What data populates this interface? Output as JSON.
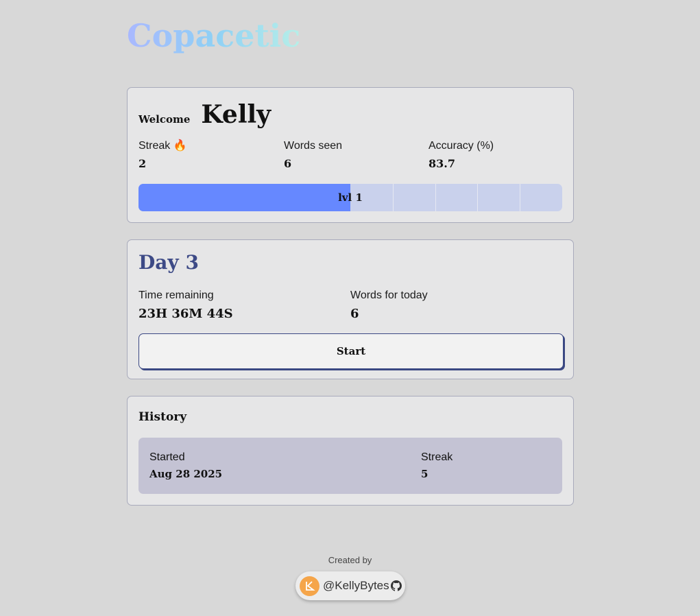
{
  "app": {
    "title": "Copacetic"
  },
  "welcome": {
    "label": "Welcome",
    "name": "Kelly",
    "stats": [
      {
        "label": "Streak 🔥",
        "value": "2"
      },
      {
        "label": "Words seen",
        "value": "6"
      },
      {
        "label": "Accuracy (%)",
        "value": "83.7"
      }
    ],
    "level": {
      "label": "lvl 1",
      "progress_fraction": 0.5,
      "segments": 10
    }
  },
  "day": {
    "title": "Day 3",
    "time_remaining_label": "Time remaining",
    "time_remaining_value": "23H 36M 44S",
    "words_today_label": "Words for today",
    "words_today_value": "6",
    "start_label": "Start"
  },
  "history": {
    "title": "History",
    "started_label": "Started",
    "started_value": "Aug 28 2025",
    "streak_label": "Streak",
    "streak_value": "5"
  },
  "footer": {
    "created_by": "Created by",
    "author": "@KellyBytes"
  },
  "colors": {
    "background": "#d8d8d8",
    "card": "#e6e6e7",
    "accent": "#3d4a86",
    "progress_fill": "#6688ff",
    "progress_track": "#c9d1ec"
  },
  "icons": [
    "fire-icon",
    "avatar-logo-icon",
    "github-icon"
  ]
}
